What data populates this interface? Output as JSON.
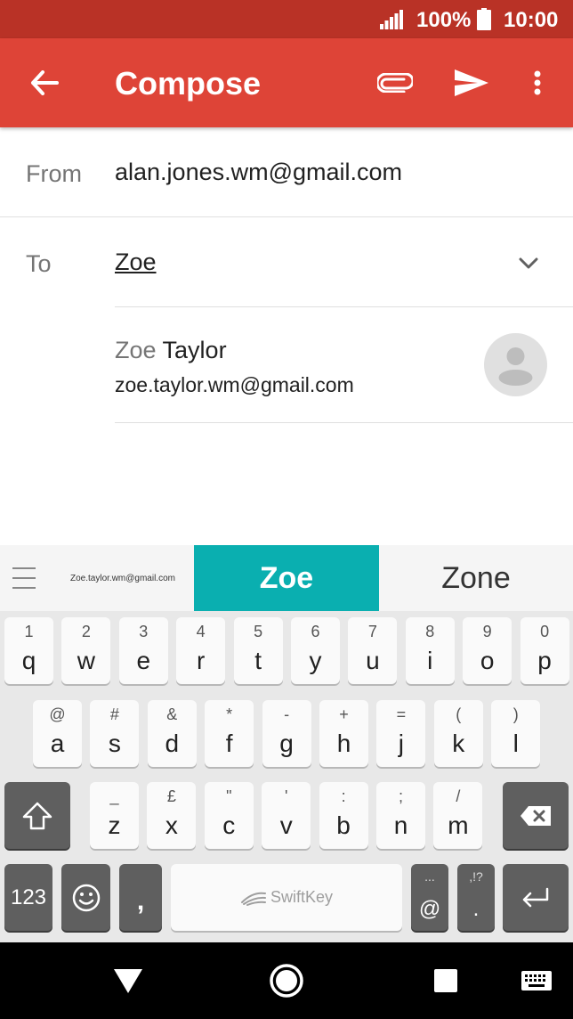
{
  "status_bar": {
    "battery": "100%",
    "time": "10:00"
  },
  "app_bar": {
    "title": "Compose",
    "accent": "#de4437",
    "status_color": "#b93226"
  },
  "from": {
    "label": "From",
    "value": "alan.jones.wm@gmail.com"
  },
  "to": {
    "label": "To",
    "value": "Zoe"
  },
  "suggestion": {
    "first_match": "Zoe",
    "rest": " Taylor",
    "email": "zoe.taylor.wm@gmail.com"
  },
  "keyboard": {
    "predictions": {
      "left": "Zoe.taylor.wm@gmail.com",
      "center": "Zoe",
      "right": "Zone",
      "highlight": "#0aafb0"
    },
    "row1": [
      {
        "hint": "1",
        "key": "q"
      },
      {
        "hint": "2",
        "key": "w"
      },
      {
        "hint": "3",
        "key": "e"
      },
      {
        "hint": "4",
        "key": "r"
      },
      {
        "hint": "5",
        "key": "t"
      },
      {
        "hint": "6",
        "key": "y"
      },
      {
        "hint": "7",
        "key": "u"
      },
      {
        "hint": "8",
        "key": "i"
      },
      {
        "hint": "9",
        "key": "o"
      },
      {
        "hint": "0",
        "key": "p"
      }
    ],
    "row2": [
      {
        "hint": "@",
        "key": "a"
      },
      {
        "hint": "#",
        "key": "s"
      },
      {
        "hint": "&",
        "key": "d"
      },
      {
        "hint": "*",
        "key": "f"
      },
      {
        "hint": "-",
        "key": "g"
      },
      {
        "hint": "+",
        "key": "h"
      },
      {
        "hint": "=",
        "key": "j"
      },
      {
        "hint": "(",
        "key": "k"
      },
      {
        "hint": ")",
        "key": "l"
      }
    ],
    "row3": [
      {
        "hint": "_",
        "key": "z"
      },
      {
        "hint": "£",
        "key": "x"
      },
      {
        "hint": "\"",
        "key": "c"
      },
      {
        "hint": "'",
        "key": "v"
      },
      {
        "hint": ":",
        "key": "b"
      },
      {
        "hint": ";",
        "key": "n"
      },
      {
        "hint": "/",
        "key": "m"
      }
    ],
    "row4": {
      "numbers": "123",
      "comma": ",",
      "space_brand": "SwiftKey",
      "at_hint": "...",
      "at": "@",
      "period_hint": ",!?",
      "period": "."
    }
  }
}
